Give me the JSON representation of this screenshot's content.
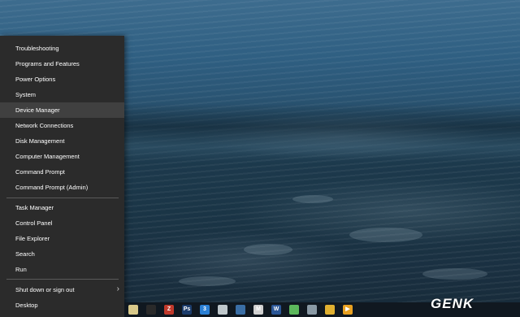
{
  "menu": {
    "items": [
      {
        "label": "Troubleshooting"
      },
      {
        "label": "Programs and Features"
      },
      {
        "label": "Power Options"
      },
      {
        "label": "System"
      },
      {
        "label": "Device Manager"
      },
      {
        "label": "Network Connections"
      },
      {
        "label": "Disk Management"
      },
      {
        "label": "Computer Management"
      },
      {
        "label": "Command Prompt"
      },
      {
        "label": "Command Prompt (Admin)"
      },
      {
        "label": "Task Manager"
      },
      {
        "label": "Control Panel"
      },
      {
        "label": "File Explorer"
      },
      {
        "label": "Search"
      },
      {
        "label": "Run"
      },
      {
        "label": "Shut down or sign out"
      },
      {
        "label": "Desktop"
      }
    ],
    "highlighted": "Device Manager",
    "submenu_arrow": "›"
  },
  "taskbar": {
    "icons": [
      {
        "name": "notepad-icon",
        "glyph": "",
        "color": "#d8c98a"
      },
      {
        "name": "recording-icon",
        "glyph": "",
        "color": "#2a2a2a"
      },
      {
        "name": "filezilla-icon",
        "glyph": "Z",
        "color": "#c0392b"
      },
      {
        "name": "photoshop-icon",
        "glyph": "Ps",
        "color": "#1b3c6b"
      },
      {
        "name": "css3-icon",
        "glyph": "3",
        "color": "#2a7fd4"
      },
      {
        "name": "cloud-sync-icon",
        "glyph": "",
        "color": "#bfc8cc"
      },
      {
        "name": "globe-icon",
        "glyph": "",
        "color": "#3a6ea5"
      },
      {
        "name": "gmail-icon",
        "glyph": "M",
        "color": "#d0d0d0"
      },
      {
        "name": "word-icon",
        "glyph": "W",
        "color": "#2b5797"
      },
      {
        "name": "messenger-icon",
        "glyph": "",
        "color": "#5cb85c"
      },
      {
        "name": "chat-icon",
        "glyph": "",
        "color": "#8a9aa5"
      },
      {
        "name": "chrome-icon",
        "glyph": "",
        "color": "#e0b030"
      },
      {
        "name": "media-player-icon",
        "glyph": "▶",
        "color": "#e8a020"
      }
    ]
  },
  "watermark": {
    "text": "GENK"
  }
}
